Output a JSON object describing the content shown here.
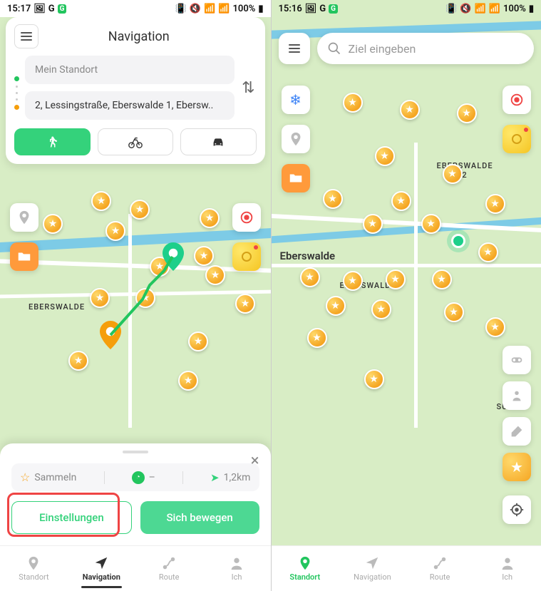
{
  "left": {
    "status": {
      "time": "15:17",
      "battery": "100%"
    },
    "nav": {
      "title": "Navigation",
      "from_placeholder": "Mein Standort",
      "to_value": "2, Lessingstraße, Eberswalde 1, Ebersw..",
      "modes": {
        "walk": "walk",
        "bike": "bike",
        "car": "car"
      }
    },
    "map": {
      "label_eberswalde": "EBERSWALDE"
    },
    "sheet": {
      "collect_label": "Sammeln",
      "time_value": "–",
      "distance_value": "1,2km",
      "settings_label": "Einstellungen",
      "move_label": "Sich bewegen"
    },
    "bottom_nav": {
      "standort": "Standort",
      "navigation": "Navigation",
      "route": "Route",
      "ich": "Ich"
    }
  },
  "right": {
    "status": {
      "time": "15:16",
      "battery": "100%"
    },
    "search": {
      "placeholder": "Ziel eingeben"
    },
    "map": {
      "label_eberswalde_main": "Eberswalde",
      "label_eberswalde_small": "EBERSWALDE",
      "label_eberswalde_2": "EBERSWALDE",
      "label_eberswalde_2_num": "2",
      "label_suden": "SÜDEN"
    },
    "bottom_nav": {
      "standort": "Standort",
      "navigation": "Navigation",
      "route": "Route",
      "ich": "Ich"
    }
  }
}
